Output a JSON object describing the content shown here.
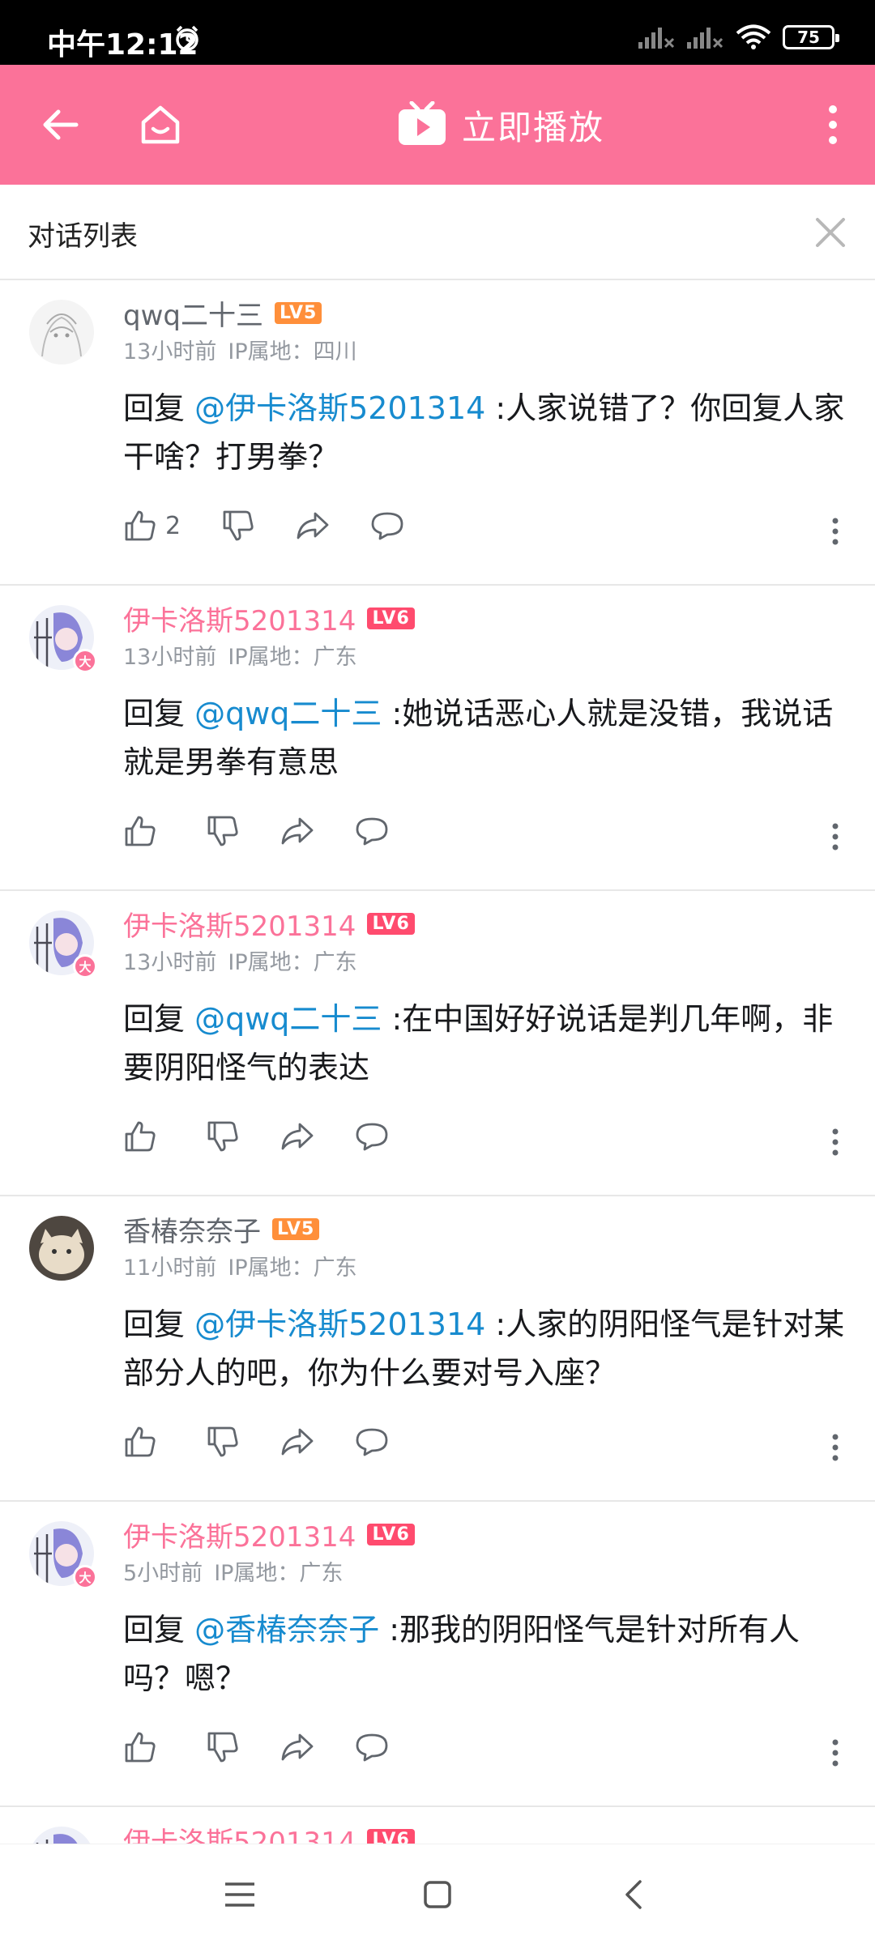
{
  "status_bar": {
    "time": "中午12:12",
    "battery": "75"
  },
  "app_bar": {
    "play_label": "立即播放"
  },
  "dialog": {
    "title": "对话列表"
  },
  "comments": [
    {
      "username": "qwq二十三",
      "level": "LV5",
      "time": "13小时前",
      "ip": "IP属地：四川",
      "reply_prefix": "回复 ",
      "mention": "@伊卡洛斯5201314",
      "text": " :人家说错了？你回复人家干啥？打男拳？",
      "like_count": "2"
    },
    {
      "username": "伊卡洛斯5201314",
      "level": "LV6",
      "time": "13小时前",
      "ip": "IP属地：广东",
      "reply_prefix": "回复 ",
      "mention": "@qwq二十三",
      "text": " :她说话恶心人就是没错，我说话就是男拳有意思",
      "like_count": ""
    },
    {
      "username": "伊卡洛斯5201314",
      "level": "LV6",
      "time": "13小时前",
      "ip": "IP属地：广东",
      "reply_prefix": "回复 ",
      "mention": "@qwq二十三",
      "text": " :在中国好好说话是判几年啊，非要阴阳怪气的表达",
      "like_count": ""
    },
    {
      "username": "香椿奈奈子",
      "level": "LV5",
      "time": "11小时前",
      "ip": "IP属地：广东",
      "reply_prefix": "回复 ",
      "mention": "@伊卡洛斯5201314",
      "text": " :人家的阴阳怪气是针对某部分人的吧，你为什么要对号入座？",
      "like_count": ""
    },
    {
      "username": "伊卡洛斯5201314",
      "level": "LV6",
      "time": "5小时前",
      "ip": "IP属地：广东",
      "reply_prefix": "回复 ",
      "mention": "@香椿奈奈子",
      "text": " :那我的阴阳怪气是针对所有人吗？嗯？",
      "like_count": ""
    }
  ],
  "partial_comment": {
    "username": "伊卡洛斯5201314",
    "level": "LV6"
  },
  "icons": {
    "back": "back-arrow-icon",
    "home": "home-icon",
    "tv": "tv-play-icon",
    "more": "more-vertical-icon",
    "close": "close-icon",
    "like": "thumbs-up-icon",
    "dislike": "thumbs-down-icon",
    "share": "share-icon",
    "reply": "comment-bubble-icon"
  },
  "colors": {
    "brand": "#fb7299",
    "mention": "#178bcf",
    "vip_name": "#fb7299"
  }
}
